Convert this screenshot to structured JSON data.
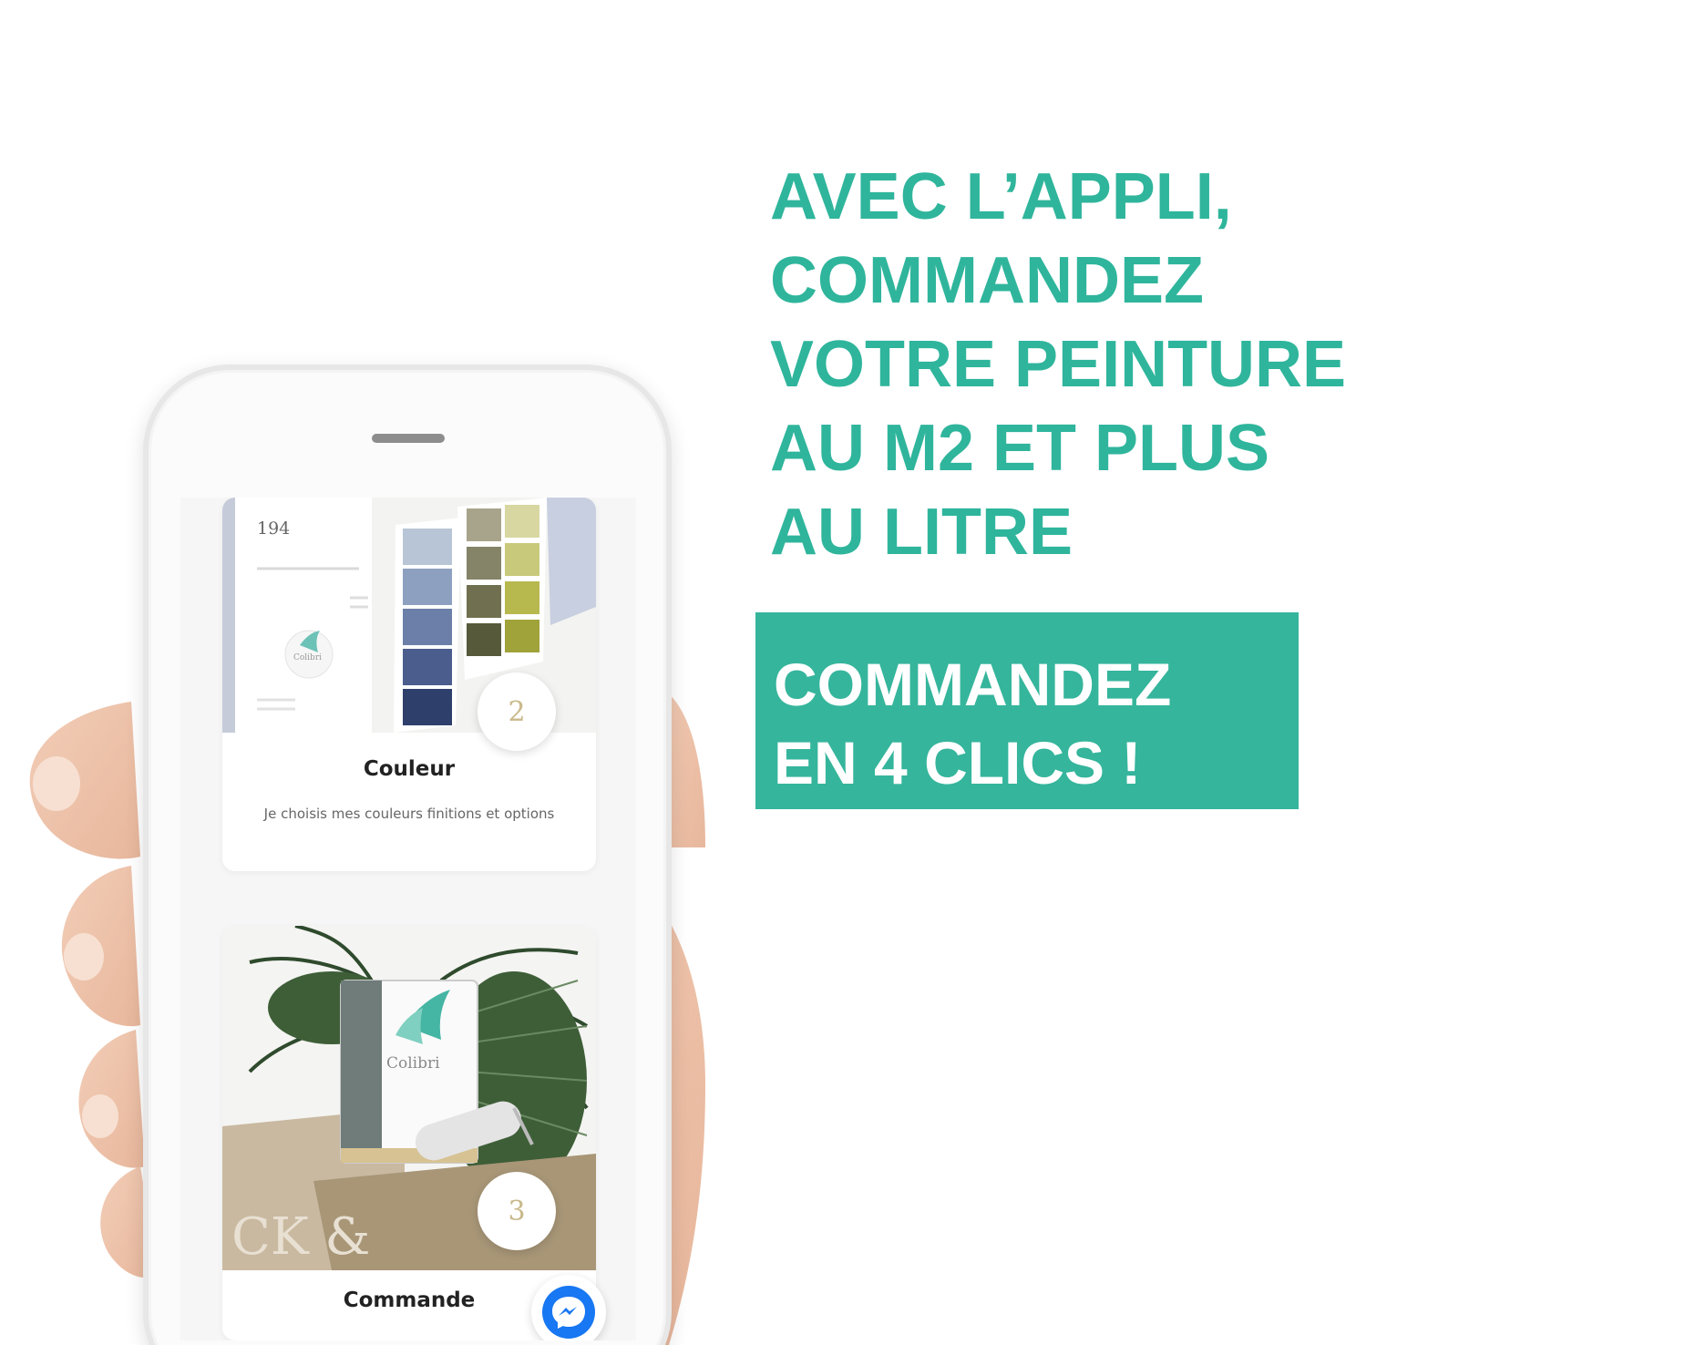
{
  "headline": {
    "lines": [
      "AVEC L’APPLI,",
      "COMMANDEZ",
      "VOTRE PEINTURE",
      "AU M2 ET PLUS",
      "AU LITRE"
    ]
  },
  "cta": {
    "lines": [
      "COMMANDEZ",
      "EN 4 CLICS !"
    ]
  },
  "phone": {
    "card_couleur": {
      "swatch_number": "194",
      "step": "2",
      "title": "Couleur",
      "description": "Je choisis mes couleurs finitions et options",
      "brand": "Colibri"
    },
    "card_commande": {
      "step": "3",
      "title": "Commande",
      "brand": "Colibri",
      "watermark": "CK &"
    },
    "chat_icon": "messenger-icon"
  },
  "colors": {
    "accent": "#2fb59c",
    "cta_background": "#35b59c",
    "messenger_blue": "#1877f2"
  }
}
